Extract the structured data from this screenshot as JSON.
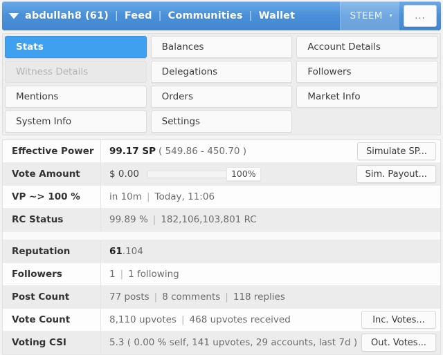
{
  "header": {
    "caret_icon": "chevron-down-icon",
    "account": "abdullah8 (61)",
    "links": [
      "Feed",
      "Communities",
      "Wallet"
    ],
    "separator": "|",
    "chain": "STEEM",
    "chain_caret": "▾",
    "more_label": "...",
    "bar_color": "#4a90d9"
  },
  "tabs": {
    "rows": [
      [
        {
          "label": "Stats",
          "state": "active"
        },
        {
          "label": "Balances",
          "state": "normal"
        },
        {
          "label": "Account Details",
          "state": "normal"
        }
      ],
      [
        {
          "label": "Witness Details",
          "state": "disabled"
        },
        {
          "label": "Delegations",
          "state": "normal"
        },
        {
          "label": "Followers",
          "state": "normal"
        }
      ],
      [
        {
          "label": "Mentions",
          "state": "normal"
        },
        {
          "label": "Orders",
          "state": "normal"
        },
        {
          "label": "Market Info",
          "state": "normal"
        }
      ],
      [
        {
          "label": "System Info",
          "state": "normal"
        },
        {
          "label": "Settings",
          "state": "normal"
        },
        {
          "label": "",
          "state": "empty"
        }
      ]
    ],
    "active_color": "#3fa0f0"
  },
  "stats": {
    "block1": [
      {
        "label": "Effective Power",
        "value_strong": "99.17 SP",
        "value_dim": "( 549.86 - 450.70 )",
        "shade": false,
        "button": "Simulate SP..."
      },
      {
        "label": "Vote Amount",
        "value_strong": "$ 0.00",
        "meter_percent": "100%",
        "meter_value": 100,
        "shade": true,
        "button": "Sim. Payout..."
      },
      {
        "label": "VP ~> 100 %",
        "value_dim": "in 10m",
        "value_extra": "Today, 11:06",
        "shade": false
      },
      {
        "label": "RC Status",
        "value_dim": "99.89 %",
        "value_extra": "182,106,103,801 RC",
        "shade": true
      }
    ],
    "block2": [
      {
        "label": "Reputation",
        "value_strong": "61",
        "value_dim": ".104",
        "shade": true
      },
      {
        "label": "Followers",
        "value_dim": "1",
        "value_extra": "1 following",
        "shade": false
      },
      {
        "label": "Post Count",
        "value_dim": "77 posts",
        "value_extra": "8 comments",
        "value_extra2": "118 replies",
        "shade": true
      },
      {
        "label": "Vote Count",
        "value_dim": "8,110 upvotes",
        "value_extra": "468 upvotes received",
        "shade": false,
        "button": "Inc. Votes..."
      },
      {
        "label": "Voting CSI",
        "value_dim": "5.3 ( 0.00 % self, 141 upvotes, 29 accounts, last 7d )",
        "shade": true,
        "button": "Out. Votes..."
      }
    ]
  }
}
